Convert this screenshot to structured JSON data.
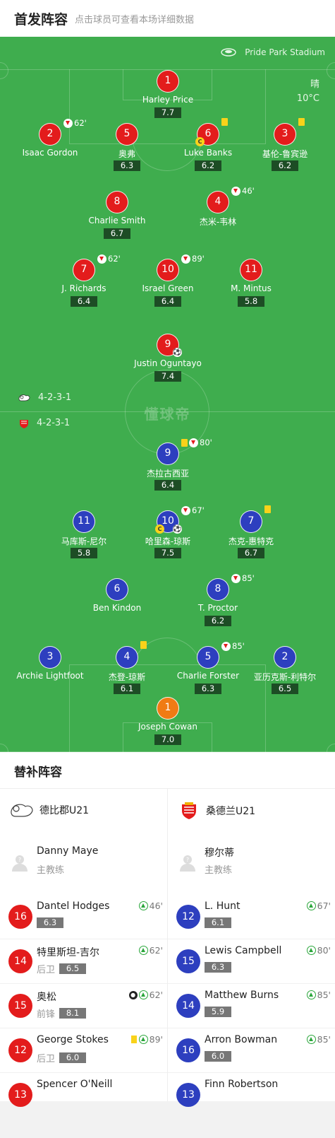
{
  "header": {
    "title": "首发阵容",
    "subtitle": "点击球员可查看本场详细数据"
  },
  "pitch": {
    "stadium": "Pride Park Stadium",
    "weather": "晴",
    "temperature": "10°C",
    "watermark": "懂球帝",
    "home_formation": "4-2-3-1",
    "away_formation": "4-2-3-1"
  },
  "home": [
    {
      "no": "1",
      "name": "Harley Price",
      "rating": "7.7"
    },
    {
      "no": "2",
      "name": "Isaac Gordon",
      "sub_min": "62'"
    },
    {
      "no": "5",
      "name": "奥弗",
      "rating": "6.3"
    },
    {
      "no": "6",
      "name": "Luke Banks",
      "rating": "6.2"
    },
    {
      "no": "3",
      "name": "基伦-鲁宾逊",
      "rating": "6.2"
    },
    {
      "no": "8",
      "name": "Charlie Smith",
      "rating": "6.7"
    },
    {
      "no": "4",
      "name": "杰米-韦林",
      "sub_min": "46'"
    },
    {
      "no": "7",
      "name": "J. Richards",
      "rating": "6.4",
      "sub_min": "62'"
    },
    {
      "no": "10",
      "name": "Israel Green",
      "rating": "6.4",
      "sub_min": "89'"
    },
    {
      "no": "11",
      "name": "M. Mintus",
      "rating": "5.8"
    },
    {
      "no": "9",
      "name": "Justin Oguntayo",
      "rating": "7.4"
    }
  ],
  "away": [
    {
      "no": "9",
      "name": "杰拉古西亚",
      "rating": "6.4",
      "sub_min": "80'"
    },
    {
      "no": "11",
      "name": "马库斯-尼尔",
      "rating": "5.8"
    },
    {
      "no": "10",
      "name": "哈里森-琼斯",
      "rating": "7.5",
      "sub_min": "67'"
    },
    {
      "no": "7",
      "name": "杰克-惠特克",
      "rating": "6.7"
    },
    {
      "no": "6",
      "name": "Ben Kindon"
    },
    {
      "no": "8",
      "name": "T. Proctor",
      "rating": "6.2",
      "sub_min": "85'"
    },
    {
      "no": "3",
      "name": "Archie Lightfoot"
    },
    {
      "no": "4",
      "name": "杰登-琼斯",
      "rating": "6.1"
    },
    {
      "no": "5",
      "name": "Charlie Forster",
      "rating": "6.3",
      "sub_min": "85'"
    },
    {
      "no": "2",
      "name": "亚历克斯-利特尔",
      "rating": "6.5"
    },
    {
      "no": "1",
      "name": "Joseph Cowan",
      "rating": "7.0"
    }
  ],
  "subs": {
    "title": "替补阵容",
    "home": {
      "team": "德比郡U21",
      "coach": "Danny Maye",
      "coach_role": "主教练",
      "players": [
        {
          "no": "16",
          "name": "Dantel Hodges",
          "rating": "6.3",
          "min": "46'"
        },
        {
          "no": "14",
          "name": "特里斯坦-吉尔",
          "pos": "后卫",
          "rating": "6.5",
          "min": "62'"
        },
        {
          "no": "15",
          "name": "奥松",
          "pos": "前锋",
          "rating": "8.1",
          "min": "62'"
        },
        {
          "no": "12",
          "name": "George Stokes",
          "pos": "后卫",
          "rating": "6.0",
          "min": "89'"
        },
        {
          "no": "13",
          "name": "Spencer O'Neill"
        }
      ]
    },
    "away": {
      "team": "桑德兰U21",
      "coach": "穆尔蒂",
      "coach_role": "主教练",
      "players": [
        {
          "no": "12",
          "name": "L. Hunt",
          "rating": "6.1",
          "min": "67'"
        },
        {
          "no": "15",
          "name": "Lewis Campbell",
          "rating": "6.3",
          "min": "80'"
        },
        {
          "no": "14",
          "name": "Matthew Burns",
          "rating": "5.9",
          "min": "85'"
        },
        {
          "no": "16",
          "name": "Arron Bowman",
          "rating": "6.0",
          "min": "85'"
        },
        {
          "no": "13",
          "name": "Finn Robertson"
        }
      ]
    }
  },
  "colors": {
    "pitch": "#3fad4e",
    "home": "#e31c1c",
    "away": "#2d3fbf",
    "keeper": "#f07b14",
    "yellow": "#f9d21a"
  },
  "icons": [
    "stadium-icon",
    "derby-ram-icon",
    "sunderland-crest-icon",
    "sub-out-icon",
    "sub-in-icon",
    "yellow-card-icon",
    "captain-icon",
    "goal-ball-icon",
    "coach-avatar-icon"
  ]
}
